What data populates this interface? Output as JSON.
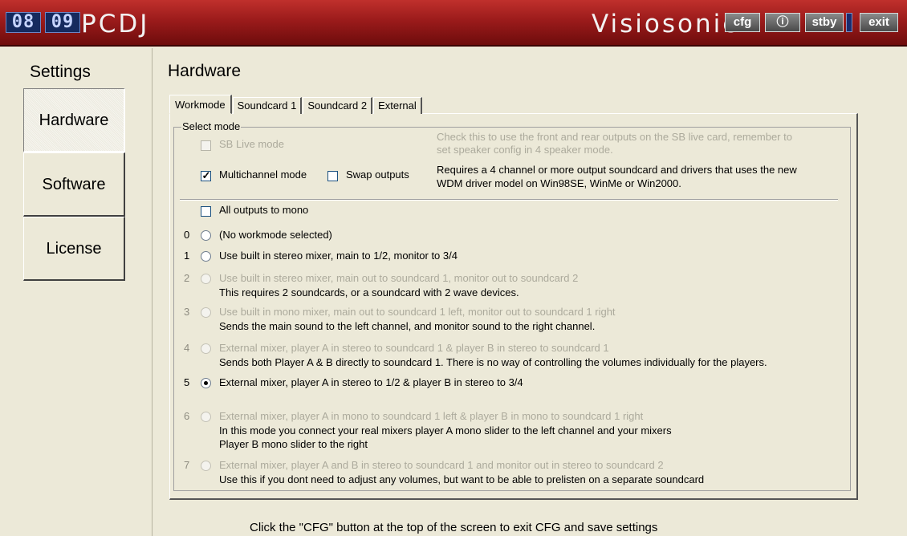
{
  "app": {
    "clock_digits": [
      "08",
      "09"
    ],
    "brand": "PCDJ",
    "vendor": "Visiosonic",
    "buttons": {
      "cfg": "cfg",
      "info": "ⓘ",
      "stby": "stby",
      "exit": "exit"
    }
  },
  "sidebar": {
    "title": "Settings",
    "items": [
      {
        "label": "Hardware",
        "active": true
      },
      {
        "label": "Software",
        "active": false
      },
      {
        "label": "License",
        "active": false
      }
    ]
  },
  "main": {
    "title": "Hardware",
    "tabs": [
      "Workmode",
      "Soundcard 1",
      "Soundcard 2",
      "External"
    ],
    "active_tab": "Workmode",
    "group_label": "Select mode",
    "sb_live": {
      "label": "SB Live mode",
      "checked": false,
      "enabled": false,
      "desc1": "Check this to use the front and rear outputs on the SB live card, remember to",
      "desc2": "set speaker config in 4 speaker mode."
    },
    "multichannel": {
      "label": "Multichannel mode",
      "checked": true,
      "desc1": "Requires a 4 channel or more output soundcard and drivers that uses the new",
      "desc2": "WDM driver model on Win98SE, WinMe or Win2000."
    },
    "swap_outputs": {
      "label": "Swap outputs",
      "checked": false
    },
    "mono": {
      "label": "All outputs to mono",
      "checked": false
    },
    "modes": [
      {
        "num": "0",
        "label": "(No workmode selected)",
        "enabled": true,
        "selected": false,
        "desc": []
      },
      {
        "num": "1",
        "label": "Use built in stereo mixer, main to 1/2, monitor to 3/4",
        "enabled": true,
        "selected": false,
        "desc": []
      },
      {
        "num": "2",
        "label": "Use built in stereo mixer, main out to soundcard 1, monitor out to soundcard 2",
        "enabled": false,
        "selected": false,
        "desc": [
          "This requires 2 soundcards, or a soundcard with 2 wave devices."
        ]
      },
      {
        "num": "3",
        "label": "Use built in mono mixer, main out to soundcard 1 left, monitor out to soundcard 1 right",
        "enabled": false,
        "selected": false,
        "desc": [
          "Sends the main sound to the left channel, and monitor sound to the right channel."
        ]
      },
      {
        "num": "4",
        "label": "External mixer, player A in stereo to soundcard 1 & player B in stereo to soundcard 1",
        "enabled": false,
        "selected": false,
        "desc": [
          "Sends both Player A & B directly to soundcard 1. There is no way of controlling the volumes individually for the players."
        ]
      },
      {
        "num": "5",
        "label": "External mixer, player A in stereo to 1/2 & player B in stereo to 3/4",
        "enabled": true,
        "selected": true,
        "desc": []
      },
      {
        "num": "6",
        "label": "External mixer, player A in mono to soundcard 1 left  & player B in mono to soundcard 1 right",
        "enabled": false,
        "selected": false,
        "desc": [
          "In this mode you connect your real mixers player A mono slider to the left channel and your mixers",
          "Player B mono slider to the right"
        ]
      },
      {
        "num": "7",
        "label": "External mixer, player A and B in stereo to soundcard 1 and monitor out in stereo to soundcard 2",
        "enabled": false,
        "selected": false,
        "desc": [
          "Use this if you dont need to adjust any volumes, but want to be able to prelisten on a separate soundcard"
        ]
      }
    ],
    "footer": "Click the \"CFG\" button at the top of the screen to exit CFG and save settings"
  }
}
